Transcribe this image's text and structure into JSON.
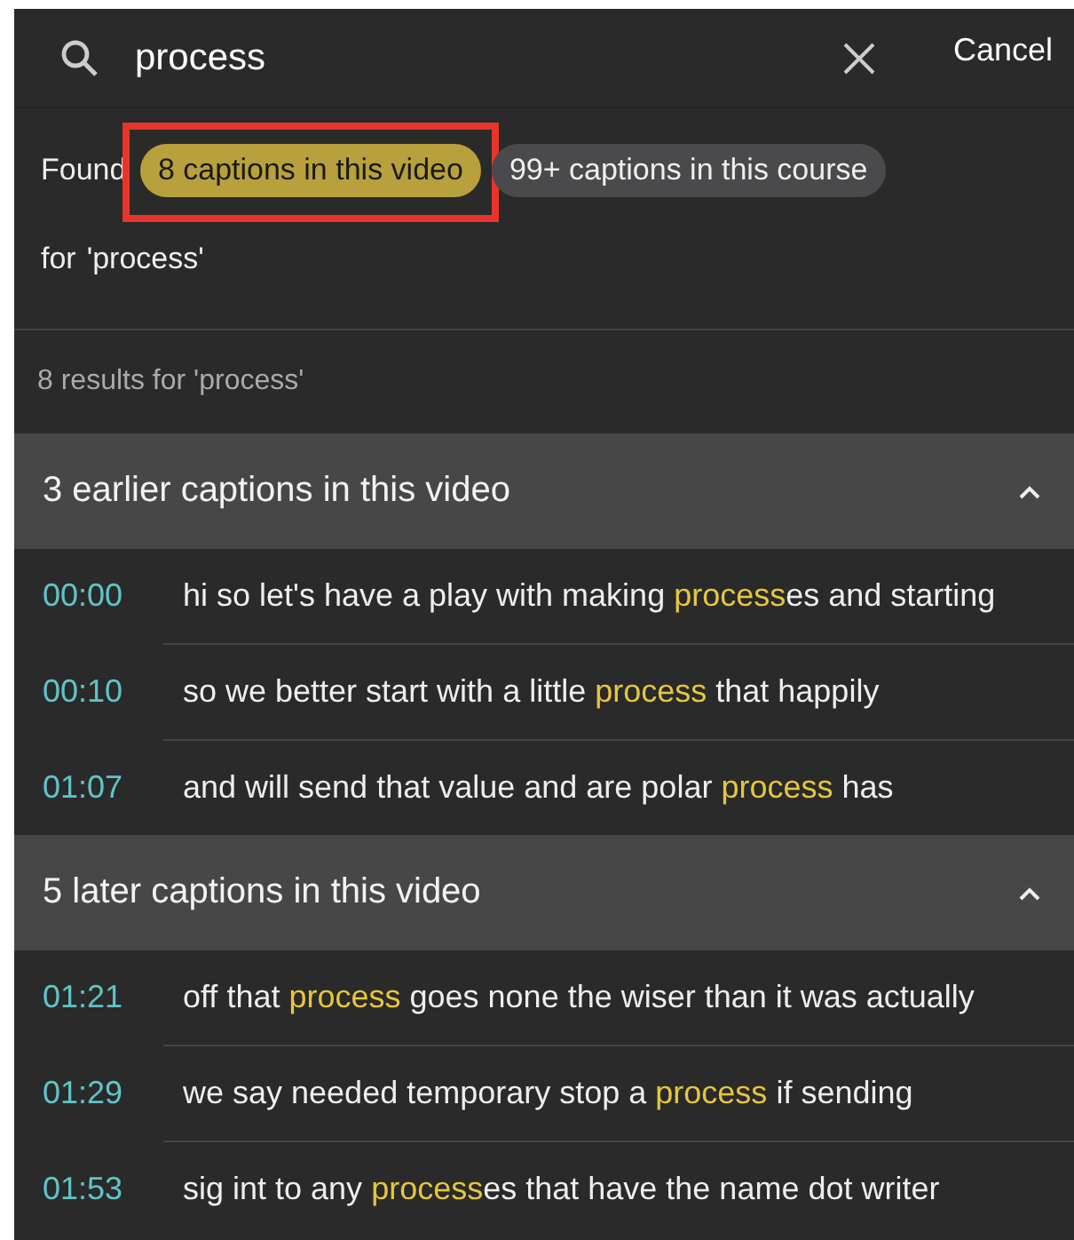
{
  "search": {
    "value": "process",
    "cancel": "Cancel"
  },
  "found": {
    "prefix": "Found",
    "chips": [
      {
        "label": "8 captions in this video",
        "selected": true,
        "highlighted": true
      },
      {
        "label": "99+ captions in this course",
        "selected": false,
        "highlighted": false
      }
    ],
    "suffix": [
      "for",
      "'process'"
    ]
  },
  "results_summary": "8 results for 'process'",
  "groups": [
    {
      "title": "3 earlier captions in this video",
      "expanded": true,
      "captions": [
        {
          "time": "00:00",
          "parts": [
            {
              "text": "hi so let's have a play with making ",
              "match": false
            },
            {
              "text": "process",
              "match": true
            },
            {
              "text": "es and starting",
              "match": false
            }
          ]
        },
        {
          "time": "00:10",
          "parts": [
            {
              "text": "so we better start with a little ",
              "match": false
            },
            {
              "text": "process",
              "match": true
            },
            {
              "text": " that happily",
              "match": false
            }
          ]
        },
        {
          "time": "01:07",
          "parts": [
            {
              "text": "and will send that value and are polar ",
              "match": false
            },
            {
              "text": "process",
              "match": true
            },
            {
              "text": " has",
              "match": false
            }
          ]
        }
      ]
    },
    {
      "title": "5 later captions in this video",
      "expanded": true,
      "captions": [
        {
          "time": "01:21",
          "parts": [
            {
              "text": "off that ",
              "match": false
            },
            {
              "text": "process",
              "match": true
            },
            {
              "text": " goes none the wiser than it was actually",
              "match": false
            }
          ]
        },
        {
          "time": "01:29",
          "parts": [
            {
              "text": "we say needed temporary stop a ",
              "match": false
            },
            {
              "text": "process",
              "match": true
            },
            {
              "text": " if sending",
              "match": false
            }
          ]
        },
        {
          "time": "01:53",
          "parts": [
            {
              "text": "sig int to any ",
              "match": false
            },
            {
              "text": "process",
              "match": true
            },
            {
              "text": "es that have the name dot writer",
              "match": false
            }
          ]
        }
      ]
    }
  ]
}
